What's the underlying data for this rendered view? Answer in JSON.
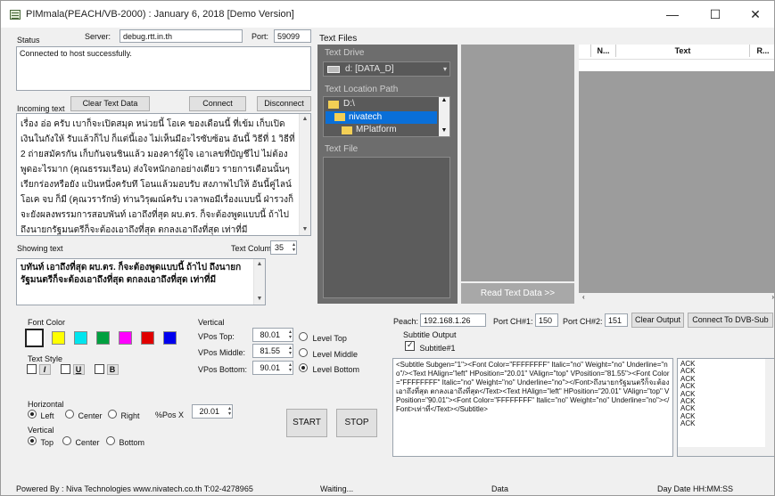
{
  "window": {
    "title": "PIMmala(PEACH/VB-2000) : January 6, 2018 [Demo Version]",
    "minimize": "—",
    "maximize": "☐",
    "close": "✕"
  },
  "status_panel": {
    "status_label": "Status",
    "server_label": "Server:",
    "server_value": "debug.rtt.in.th",
    "port_label": "Port:",
    "port_value": "59099",
    "status_message": "Connected to host successfully."
  },
  "incoming": {
    "label": "Incoming text",
    "clear_button": "Clear Text Data",
    "connect_button": "Connect",
    "disconnect_button": "Disconnect",
    "text": "เรื่อง อ่อ ครับ เบาก็จะเปิดสมุด หน่วยนี้ โอเค ของเดือนนี้ ที่เข้ม เก็บเปิดเงินในกังให้ รับแล้วก็ไป ก็แต่นี้เอง ไม่เห็นมีอะไรซับซ้อน อันนี้ วิธีที่ 1 วิธีที่ 2 ถ่ายสมัครกัน เก็บกันจนชินแล้ว มองคาร์ผู้ใจ เอาเลขที่บัญชีไป ไม่ต้องพูดอะไรมาก (คุณธรรมเรือน) ส่งใจหนักอกอย่างเดียว รายการเดือนนั้นๆ เรียกร่องหรือยัง แป้นหนึ่งครับทึ โอนแล้วมอบรับ สงภาพไปให้ อันนี้คู่ไลน์ โอเค จบ ก็มี (คุณวรารักษ์) ท่านวิรุฒณ์ครับ เวลาพอมีเรื่องแบบนี้ ฝ่ารวงก็จะยังผลงพรรมการสอบพันท์ เอาถึงที่สุด ผบ.ตร. ก็จะต้องพูดแบบนี้ ถ้าไปถึงนายกรัฐมนตรีก็จะต้องเอาถึงที่สุด ตกลงเอาถึงที่สุด เท่าที่มี"
  },
  "showing": {
    "label": "Showing text",
    "column_label": "Text Column",
    "column_value": "35",
    "text": "บทันท์ เอาถึงที่สุด ผบ.ตร. ก็จะต้องพูดแบบนี้ ถ้าไป ถึงนายกรัฐมนตรีก็จะต้องเอาถึงที่สุด ตกลงเอาถึงที่สุด เท่าที่มี"
  },
  "text_files": {
    "label": "Text Files",
    "drive_label": "Text Drive",
    "drive_value": "d: [DATA_D]",
    "location_label": "Text Location Path",
    "folders": [
      "D:\\",
      "nivatech",
      "MPlatform"
    ],
    "file_label": "Text File"
  },
  "read_button": "Read Text Data >>",
  "grid": {
    "columns": [
      "N...",
      "Text",
      "R..."
    ]
  },
  "font": {
    "color_label": "Font Color",
    "colors": [
      "#ffffff",
      "#ffff00",
      "#00e5ee",
      "#00a040",
      "#ff00ff",
      "#e00000",
      "#0000ee"
    ],
    "style_label": "Text Style",
    "italic": "I",
    "underline": "U",
    "bold": "B"
  },
  "vertical": {
    "label": "Vertical",
    "top_label": "VPos Top:",
    "top_value": "80.01",
    "middle_label": "VPos Middle:",
    "middle_value": "81.55",
    "bottom_label": "VPos Bottom:",
    "bottom_value": "90.01",
    "level_top": "Level Top",
    "level_middle": "Level Middle",
    "level_bottom": "Level Bottom"
  },
  "horizontal": {
    "label": "Horizontal",
    "left": "Left",
    "center": "Center",
    "right": "Right",
    "hpos_label": "%Pos X",
    "hpos_value": "20.01"
  },
  "vertical2": {
    "label": "Vertical",
    "top": "Top",
    "center": "Center",
    "bottom": "Bottom"
  },
  "controls": {
    "start": "START",
    "stop": "STOP"
  },
  "peach": {
    "label": "Peach:",
    "ip": "192.168.1.26",
    "port1_label": "Port CH#1:",
    "port1": "150",
    "port2_label": "Port CH#2:",
    "port2": "151",
    "clear_output": "Clear Output",
    "connect_dvb": "Connect To DVB-Sub",
    "subtitle_output_label": "Subtitle Output",
    "subtitle1": "Subtitle#1",
    "output_text": "<Subtitle Subgen=\"1\"><Font Color=\"FFFFFFFF\" Italic=\"no\" Weight=\"no\" Underline=\"no\"/><Text HAlign=\"left\" HPosition=\"20.01\" VAlign=\"top\" VPosition=\"81.55\"><Font Color=\"FFFFFFFF\" Italic=\"no\" Weight=\"no\" Underline=\"no\"></Font>ถึงนายกรัฐมนตรีก็จะต้องเอาถึงที่สุด ตกลงเอาถึงที่สุด</Text><Text HAlign=\"left\" HPosition=\"20.01\" VAlign=\"top\" VPosition=\"90.01\"><Font Color=\"FFFFFFFF\" Italic=\"no\" Weight=\"no\" Underline=\"no\"></Font>เท่าที่</Text></Subtitle>",
    "ack_list": [
      "ACK",
      "ACK",
      "ACK",
      "ACK",
      "ACK",
      "ACK",
      "ACK",
      "ACK",
      "ACK"
    ]
  },
  "statusbar": {
    "powered": "Powered By : Niva Technologies www.nivatech.co.th T:02-4278965",
    "waiting": "Waiting...",
    "data": "Data",
    "datetime": "Day Date HH:MM:SS"
  }
}
